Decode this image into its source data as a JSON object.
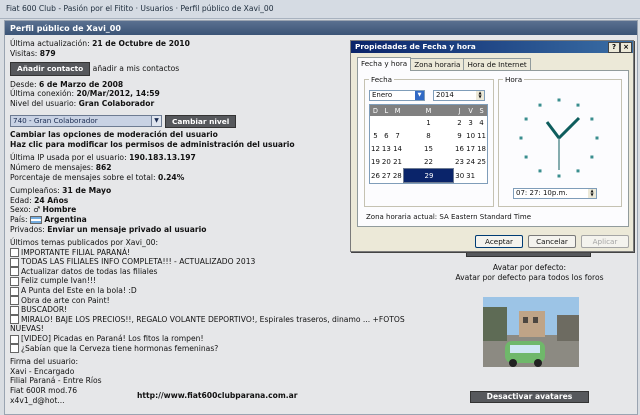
{
  "window": {
    "title": "Fiat 600 Club - Pasión por el Fitito · Usuarios · Perfil público de Xavi_00"
  },
  "profile": {
    "header": "Perfil público de Xavi_00",
    "last_update_label": "Última actualización:",
    "last_update": "21 de Octubre de 2010",
    "visits_label": "Visitas:",
    "visits": "879",
    "add_contact": "Añadir contacto",
    "add_contact_desc": "añadir a mis contactos",
    "since_label": "Desde:",
    "since": "6 de Marzo de 2008",
    "last_conn_label": "Última conexión:",
    "last_conn": "20/Mar/2012, 14:59",
    "level_label": "Nivel del usuario:",
    "level": "Gran Colaborador",
    "level_select": "740 - Gran Colaborador",
    "change_level": "Cambiar nivel",
    "mod_options": "Cambiar las opciones de moderación del usuario",
    "admin_perms": "Haz clic para modificar los permisos de administración del usuario",
    "ip_label": "Última IP usada por el usuario:",
    "ip": "190.183.13.197",
    "msgs_label": "Número de mensajes:",
    "msgs": "862",
    "pct_label": "Porcentaje de mensajes sobre el total:",
    "pct": "0.24%",
    "bday_label": "Cumpleaños:",
    "bday": "31 de Mayo",
    "age_label": "Edad:",
    "age": "24 Años",
    "sex_label": "Sexo:",
    "sex": "Hombre",
    "country_label": "País:",
    "country": "Argentina",
    "private_label": "Privados:",
    "private": "Enviar un mensaje privado al usuario",
    "topics_label": "Últimos temas publicados por Xavi_00:",
    "topics": [
      "IMPORTANTE FILIAL PARANÁ!",
      "TODAS LAS FILIALES INFO COMPLETA!!! - ACTUALIZADO 2013",
      "Actualizar datos de todas las filiales",
      "Feliz cumple Ivan!!!",
      "A Punta del Este en la bola! :D",
      "Obra de arte con Paint!",
      "BUSCADOR!",
      "MIRALO! BAJE LOS PRECIOS!!, REGALO VOLANTE DEPORTIVO!, Espirales traseros, dinamo ... +FOTOS",
      "[VIDEO] Picadas en Paraná! Los fitos la rompen!",
      "¿Sabían que la Cerveza tiene hormonas femeninas?"
    ],
    "topic_cont": "NUEVAS!",
    "sig_label": "Firma del usuario:",
    "sig": [
      "Xavi - Encargado",
      "Filial Paraná - Entre Ríos",
      "Fiat 600R mod.76",
      "x4v1_d@hot..."
    ],
    "site": "http://www.fiat600clubparana.com.ar"
  },
  "avatar": {
    "default_label": "Avatar por defecto:",
    "default_desc": "Avatar por defecto para todos los foros",
    "disable": "Desactivar avatares"
  },
  "dialog": {
    "title": "Propiedades de Fecha y hora",
    "tabs": [
      "Fecha y hora",
      "Zona horaria",
      "Hora de Internet"
    ],
    "fecha_label": "Fecha",
    "hora_label": "Hora",
    "month": "Enero",
    "year": "2014",
    "weekdays": [
      "D",
      "L",
      "M",
      "M",
      "J",
      "V",
      "S"
    ],
    "weeks": [
      [
        "",
        "",
        "",
        "1",
        "2",
        "3",
        "4"
      ],
      [
        "5",
        "6",
        "7",
        "8",
        "9",
        "10",
        "11"
      ],
      [
        "12",
        "13",
        "14",
        "15",
        "16",
        "17",
        "18"
      ],
      [
        "19",
        "20",
        "21",
        "22",
        "23",
        "24",
        "25"
      ],
      [
        "26",
        "27",
        "28",
        "29",
        "30",
        "31",
        ""
      ]
    ],
    "selected_day": "29",
    "time": "07: 27: 10p.m.",
    "tz": "Zona horaria actual:  SA Eastern Standard Time",
    "ok": "Aceptar",
    "cancel": "Cancelar",
    "apply": "Aplicar"
  }
}
